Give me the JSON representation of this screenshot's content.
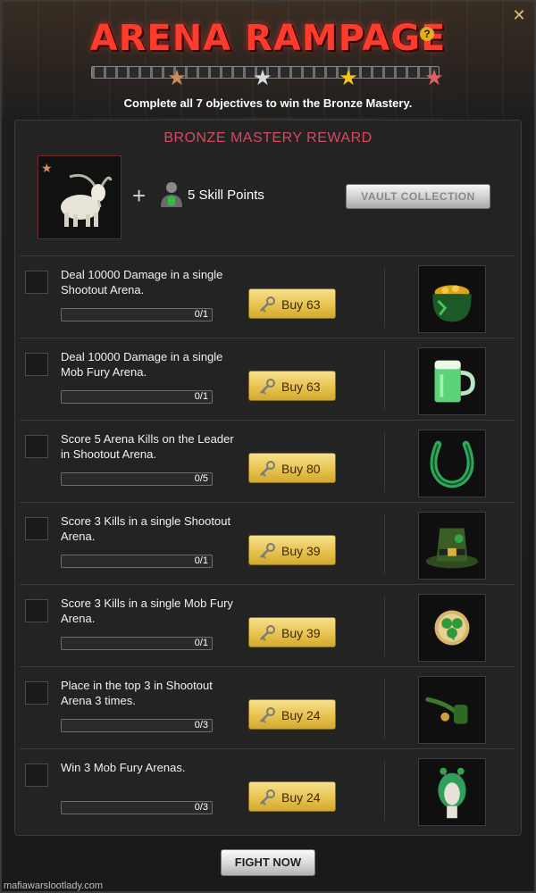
{
  "header": {
    "title": "ARENA RAMPAGE",
    "help_symbol": "?",
    "close_symbol": "✕",
    "subtitle": "Complete all 7 objectives to win the Bronze Mastery.",
    "mastery_stars": [
      "bronze-star-icon",
      "silver-star-icon",
      "gold-star-icon",
      "ruby-star-icon"
    ]
  },
  "reward": {
    "title": "BRONZE MASTERY REWARD",
    "item_icon": "goat-icon",
    "plus": "+",
    "skill_points_label": "5 Skill Points",
    "vault_button_label": "VAULT COLLECTION"
  },
  "objectives": [
    {
      "text": "Deal 10000 Damage in a single Shootout Arena.",
      "progress": "0/1",
      "progress_fraction": 0,
      "buy_label": "Buy 63",
      "item_icon": "pot-of-gold-icon"
    },
    {
      "text": "Deal 10000 Damage in a single Mob Fury Arena.",
      "progress": "0/1",
      "progress_fraction": 0,
      "buy_label": "Buy 63",
      "item_icon": "green-beer-mug-icon"
    },
    {
      "text": "Score 5 Arena Kills on the Leader in Shootout Arena.",
      "progress": "0/5",
      "progress_fraction": 0,
      "buy_label": "Buy 80",
      "item_icon": "horseshoe-icon"
    },
    {
      "text": "Score 3 Kills in a single Shootout Arena.",
      "progress": "0/1",
      "progress_fraction": 0,
      "buy_label": "Buy 39",
      "item_icon": "leprechaun-hat-icon"
    },
    {
      "text": "Score 3 Kills in a single Mob Fury Arena.",
      "progress": "0/1",
      "progress_fraction": 0,
      "buy_label": "Buy 39",
      "item_icon": "clover-badge-icon"
    },
    {
      "text": "Place in the top 3 in Shootout Arena 3 times.",
      "progress": "0/3",
      "progress_fraction": 0,
      "buy_label": "Buy 24",
      "item_icon": "pipe-icon"
    },
    {
      "text": "Win 3 Mob Fury Arenas.",
      "progress": "0/3",
      "progress_fraction": 0,
      "buy_label": "Buy 24",
      "item_icon": "green-wig-icon"
    }
  ],
  "footer": {
    "fight_button_label": "FIGHT NOW",
    "watermark": "mafiawarslootlady.com"
  },
  "colors": {
    "title_red": "#ff3b2e",
    "reward_title": "#d9485f",
    "buy_gold": "#e6c04b"
  }
}
